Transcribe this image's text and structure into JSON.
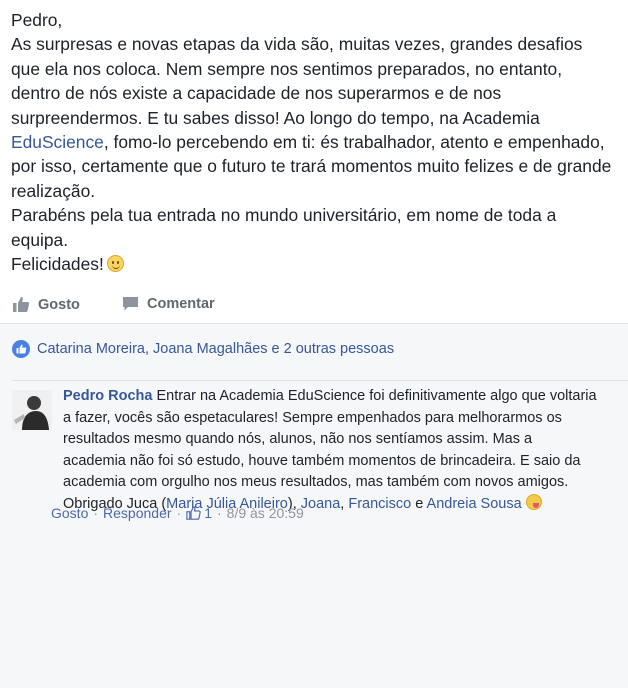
{
  "post": {
    "lines": [
      "Pedro,",
      "As surpresas e novas etapas da vida são, muitas vezes, grandes desafios",
      "que ela nos coloca. Nem sempre nos sentimos preparados, no entanto,",
      "dentro de nós existe a capacidade de nos superarmos e de nos",
      "surpreendermos. E tu sabes disso! Ao longo do tempo, na Academia",
      "fomo-lo percebendo em ti: és trabalhador, atento e empenhado,",
      "por isso, certamente que o futuro te trará momentos muito felizes e de grande",
      "realização.",
      "Parabéns pela tua entrada no mundo universitário, em nome de toda a",
      "equipa.",
      "Felicidades!"
    ],
    "page_link": "EduScience"
  },
  "actions": {
    "like_label": "Gosto",
    "comment_label": "Comentar"
  },
  "reactions": {
    "likers_text": "Catarina Moreira, Joana Magalhães e 2 outras pessoas"
  },
  "comment": {
    "author": "Pedro Rocha",
    "line1": "Entrar na Academia EduScience foi definitivamente algo que voltaria",
    "line2": "a fazer, vocês são espetaculares! Sempre empenhados para melhorarmos os",
    "line3": "resultados mesmo quando nós, alunos, não nos sentíamos assim. Mas a",
    "line4": "academia não foi só estudo, houve também momentos de brincadeira. E saio da",
    "line5": "academia com orgulho nos meus resultados, mas também com novos amigos.",
    "line6_prefix": "Obrigado Juca (",
    "tag1": "Maria Júlia Anileiro",
    "sep1": "),",
    "tag2": "Joana",
    "sep2": ",",
    "tag3": "Francisco",
    "sep3": "e",
    "tag4": "Andreia Sousa",
    "like_label": "Gosto",
    "reply_label": "Responder",
    "like_count": "1",
    "timestamp": "8/9 às 20:59",
    "dot": "·"
  },
  "colors": {
    "link": "#365899",
    "background_secondary": "#f6f7f9",
    "like_badge": "#4a7fe6",
    "meta_grey": "#90949c"
  }
}
